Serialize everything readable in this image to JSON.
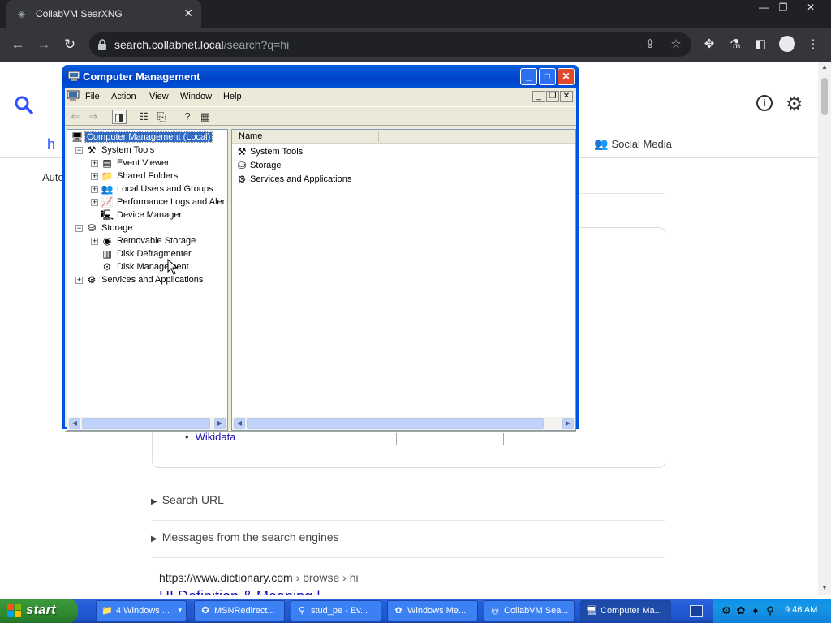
{
  "browser": {
    "tab_title": "CollabVM SearXNG",
    "url_host": "search.collabnet.local",
    "url_path": "/search?q=hi"
  },
  "searx": {
    "query_fragment": "h",
    "tab_social": "Social Media",
    "autocomplete_prefix": "Auto",
    "wikidata_link": "Wikidata",
    "search_url_label": "Search URL",
    "messages_label": "Messages from the search engines",
    "result_url": "https://www.dictionary.com",
    "result_breadcrumb": "› browse › hi",
    "result_title": "HI Definition & Meaning | Dictionary.com"
  },
  "window": {
    "title": "Computer Management",
    "menu": [
      "File",
      "Action",
      "View",
      "Window",
      "Help"
    ],
    "tree": [
      {
        "label": "Computer Management (Local)",
        "level": 0,
        "expander": "",
        "icon": "computer-icon",
        "selected": true
      },
      {
        "label": "System Tools",
        "level": 1,
        "expander": "−",
        "icon": "tools-icon"
      },
      {
        "label": "Event Viewer",
        "level": 2,
        "expander": "+",
        "icon": "event-viewer-icon"
      },
      {
        "label": "Shared Folders",
        "level": 2,
        "expander": "+",
        "icon": "folder-icon"
      },
      {
        "label": "Local Users and Groups",
        "level": 2,
        "expander": "+",
        "icon": "users-icon"
      },
      {
        "label": "Performance Logs and Alerts",
        "level": 2,
        "expander": "+",
        "icon": "perf-icon"
      },
      {
        "label": "Device Manager",
        "level": 2,
        "expander": "",
        "icon": "device-manager-icon"
      },
      {
        "label": "Storage",
        "level": 1,
        "expander": "−",
        "icon": "storage-icon"
      },
      {
        "label": "Removable Storage",
        "level": 2,
        "expander": "+",
        "icon": "removable-storage-icon"
      },
      {
        "label": "Disk Defragmenter",
        "level": 2,
        "expander": "",
        "icon": "defrag-icon"
      },
      {
        "label": "Disk Management",
        "level": 2,
        "expander": "",
        "icon": "disk-management-icon"
      },
      {
        "label": "Services and Applications",
        "level": 1,
        "expander": "+",
        "icon": "services-icon"
      }
    ],
    "column_name": "Name",
    "list": [
      {
        "label": "System Tools",
        "icon": "tools-icon"
      },
      {
        "label": "Storage",
        "icon": "storage-icon"
      },
      {
        "label": "Services and Applications",
        "icon": "services-icon"
      }
    ]
  },
  "taskbar": {
    "start_label": "start",
    "buttons": [
      {
        "label": "4 Windows ...",
        "icon": "folder-icon",
        "group": true
      },
      {
        "label": "MSNRedirect...",
        "icon": "msn-icon"
      },
      {
        "label": "stud_pe - Ev...",
        "icon": "search-icon"
      },
      {
        "label": "Windows Me...",
        "icon": "messenger-icon"
      },
      {
        "label": "CollabVM Sea...",
        "icon": "chrome-icon"
      },
      {
        "label": "Computer Ma...",
        "icon": "computer-icon",
        "active": true
      }
    ],
    "clock": "9:46 AM"
  }
}
